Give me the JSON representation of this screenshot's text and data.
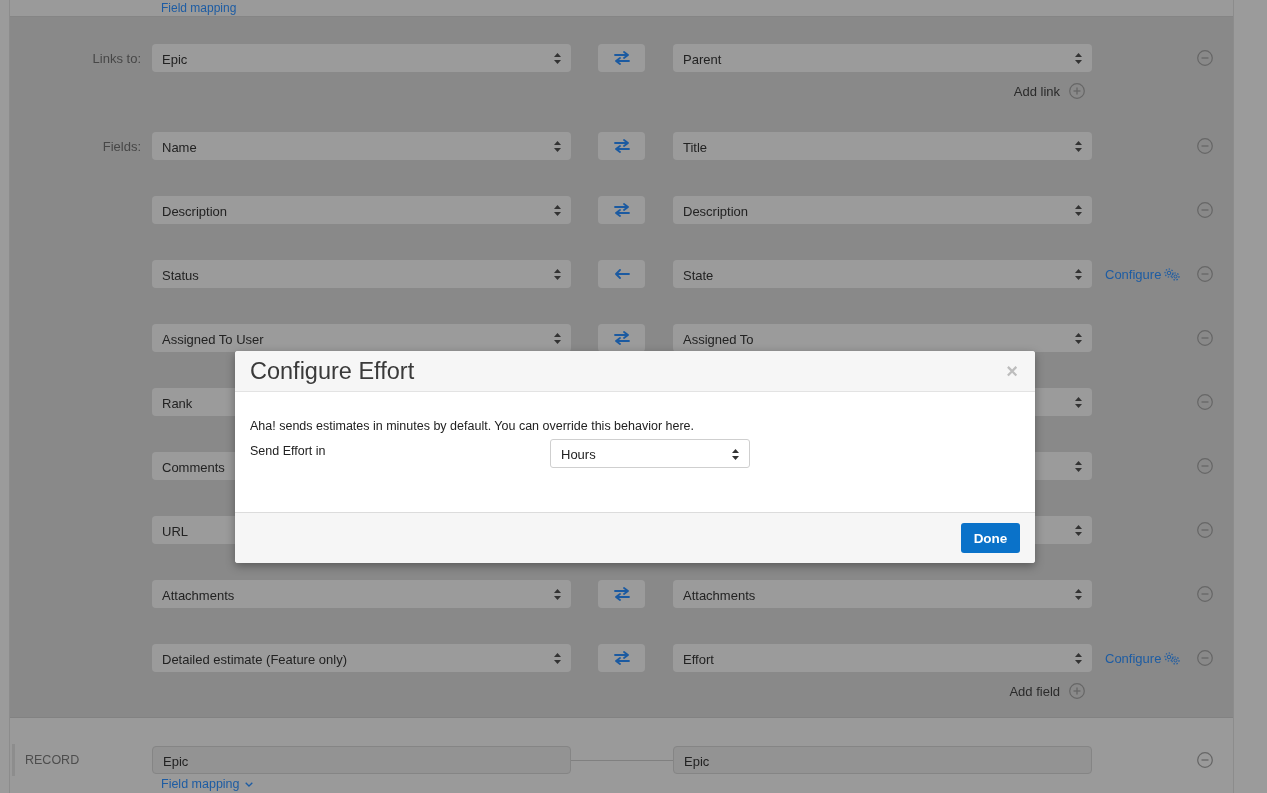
{
  "top_link": {
    "label": "Field mapping"
  },
  "links": {
    "label": "Links to:",
    "rows": [
      {
        "left": "Epic",
        "kind": "twoway",
        "right": "Parent"
      }
    ],
    "add_label": "Add link"
  },
  "fields": {
    "label": "Fields:",
    "rows": [
      {
        "left": "Name",
        "kind": "twoway",
        "right": "Title"
      },
      {
        "left": "Description",
        "kind": "twoway",
        "right": "Description"
      },
      {
        "left": "Status",
        "kind": "leftward",
        "right": "State",
        "configure": "Configure"
      },
      {
        "left": "Assigned To User",
        "kind": "twoway",
        "right": "Assigned To"
      },
      {
        "left": "Rank"
      },
      {
        "left": "Comments"
      },
      {
        "left": "URL"
      },
      {
        "left": "Attachments",
        "kind": "twoway",
        "right": "Attachments"
      },
      {
        "left": "Detailed estimate (Feature only)",
        "kind": "twoway",
        "right": "Effort",
        "configure": "Configure"
      }
    ],
    "add_label": "Add field"
  },
  "record": {
    "label": "RECORD",
    "left": "Epic",
    "right": "Epic",
    "link": "Field mapping"
  },
  "modal": {
    "title": "Configure Effort",
    "close": "×",
    "message": "Aha! sends estimates in minutes by default. You can override this behavior here.",
    "setting_label": "Send Effort in",
    "setting_value": "Hours",
    "done": "Done"
  }
}
